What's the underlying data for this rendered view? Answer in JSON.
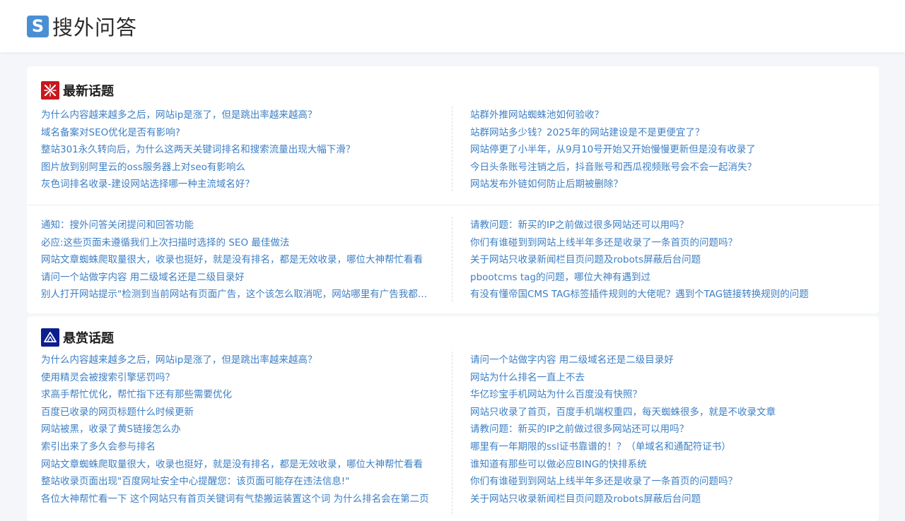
{
  "header": {
    "logo_mark": "S",
    "logo_text": "搜外问答"
  },
  "hot": {
    "title": "最新话题",
    "icon": "crossed-logo-icon",
    "group1": {
      "left": [
        "为什么内容越来越多之后，网站ip是涨了，但是跳出率越来越高？",
        "域名备案对SEO优化是否有影响?",
        "整站301永久转向后，为什么这两天关键词排名和搜索流量出现大幅下滑？",
        "图片放到别阿里云的oss服务器上对seo有影响么",
        "灰色词排名收录-建设网站选择哪一种主流域名好？"
      ],
      "right": [
        "站群外推网站蜘蛛池如何验收？",
        "站群网站多少钱？2025年的网站建设是不是更便宜了？",
        "网站停更了小半年，从9月10号开始又开始慢慢更新但是没有收录了",
        "今日头条账号注销之后，抖音账号和西瓜视频账号会不会一起消失？",
        "网站发布外链如何防止后期被删除？"
      ]
    },
    "group2": {
      "left": [
        "通知：搜外问答关闭提问和回答功能",
        "必应:这些页面未遵循我们上次扫描时选择的 SEO 最佳做法",
        "网站文章蜘蛛爬取量很大，收录也挺好，就是没有排名，都是无效收录，哪位大神帮忙看看",
        "请问一个站做字内容 用二级域名还是二级目录好",
        "别人打开网站提示\"检测到当前网站有页面广告，这个该怎么取消呢，网站哪里有广告我都删了"
      ],
      "right": [
        "请教问题：新买的IP之前做过很多网站还可以用吗？",
        "你们有谁碰到到网站上线半年多还是收录了一条首页的问题吗？",
        "关于网站只收录新闻栏目页问题及robots屏蔽后台问题",
        "pbootcms tag的问题，哪位大神有遇到过",
        "有没有懂帝国CMS TAG标签插件规则的大佬呢？遇到个TAG链接转换规则的问题"
      ]
    }
  },
  "reward": {
    "title": "悬赏话题",
    "icon": "mountain-logo-icon",
    "left": [
      "为什么内容越来越多之后，网站ip是涨了，但是跳出率越来越高？",
      "使用精灵会被搜索引擎惩罚吗？",
      "求高手帮忙优化，帮忙指下还有那些需要优化",
      "百度已收录的网页标题什么时候更新",
      "网站被黑，收录了黄S链接怎么办",
      "索引出来了多久会参与排名",
      "网站文章蜘蛛爬取量很大，收录也挺好，就是没有排名，都是无效收录，哪位大神帮忙看看",
      "整站收录页面出现\"百度网址安全中心提醒您：该页面可能存在违法信息!\"",
      "各位大神帮忙看一下 这个网站只有首页关键词有气垫搬运装置这个词 为什么排名会在第二页"
    ],
    "right": [
      "请问一个站做字内容 用二级域名还是二级目录好",
      "网站为什么排名一直上不去",
      "华亿珍宝手机网站为什么百度没有快照？",
      "网站只收录了首页，百度手机端权重四，每天蜘蛛很多，就是不收录文章",
      "请教问题：新买的IP之前做过很多网站还可以用吗？",
      "哪里有一年期限的ssl证书靠谱的！？（单域名和通配符证书）",
      "谁知道有那些可以做必应BING的快排系统",
      "你们有谁碰到到网站上线半年多还是收录了一条首页的问题吗？",
      "关于网站只收录新闻栏目页问题及robots屏蔽后台问题"
    ]
  },
  "colors": {
    "link": "#3d7fc4",
    "logo": "#4a8fd4",
    "hot_icon": "#c8171e",
    "reward_icon": "#0b1f8f"
  }
}
